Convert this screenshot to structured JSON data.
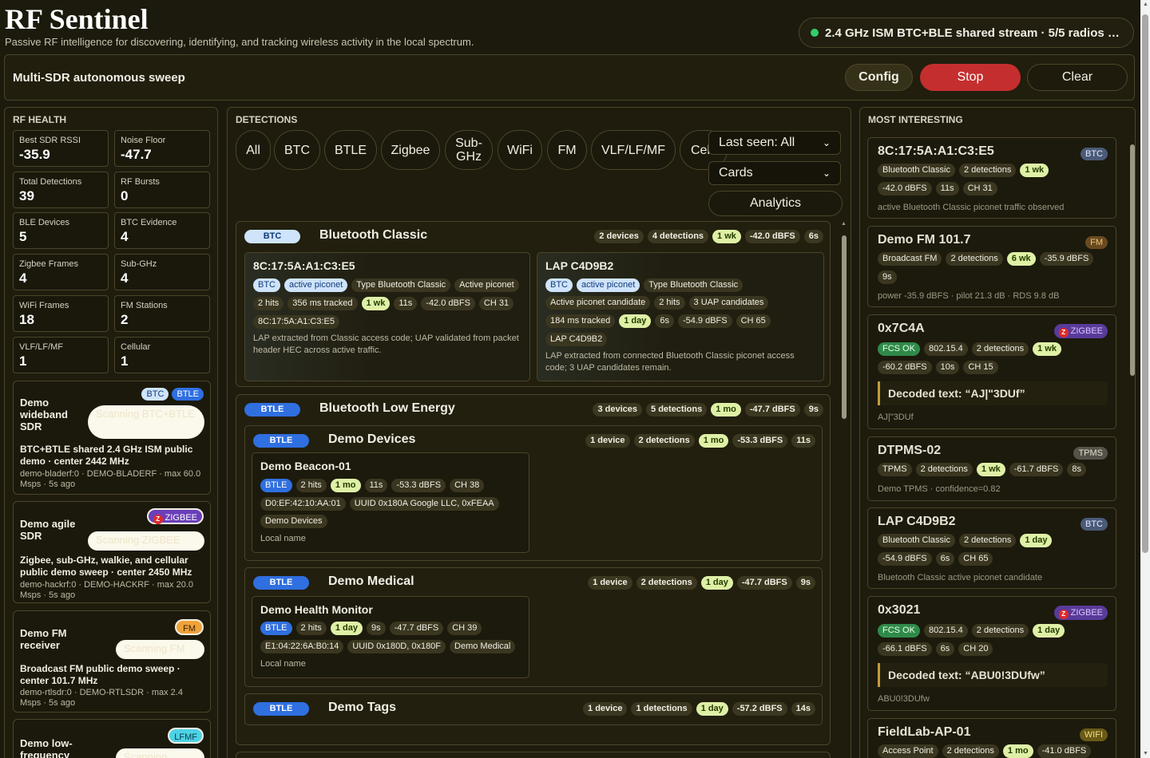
{
  "app": {
    "title": "RF Sentinel",
    "subtitle": "Passive RF intelligence for discovering, identifying, and tracking wireless activity in the local spectrum.",
    "status": "2.4 GHz ISM BTC+BLE shared stream · 5/5 radios …"
  },
  "sweep": {
    "title": "Multi-SDR autonomous sweep",
    "config": "Config",
    "stop": "Stop",
    "clear": "Clear"
  },
  "health": {
    "title": "RF HEALTH",
    "stats": [
      {
        "label": "Best SDR RSSI",
        "value": "-35.9"
      },
      {
        "label": "Noise Floor",
        "value": "-47.7"
      },
      {
        "label": "Total Detections",
        "value": "39"
      },
      {
        "label": "RF Bursts",
        "value": "0"
      },
      {
        "label": "BLE Devices",
        "value": "5"
      },
      {
        "label": "BTC Evidence",
        "value": "4"
      },
      {
        "label": "Zigbee Frames",
        "value": "4"
      },
      {
        "label": "Sub-GHz",
        "value": "4"
      },
      {
        "label": "WiFi Frames",
        "value": "18"
      },
      {
        "label": "FM Stations",
        "value": "2"
      },
      {
        "label": "VLF/LF/MF",
        "value": "1"
      },
      {
        "label": "Cellular",
        "value": "1"
      }
    ],
    "sdrs": [
      {
        "name": "Demo wideband SDR",
        "tags": [
          "BTC",
          "BTLE"
        ],
        "scan": "Scanning BTC+BTLE",
        "desc": "BTC+BTLE shared 2.4 GHz ISM public demo · center 2442 MHz",
        "meta": "demo-bladerf:0 · DEMO-BLADERF · max 60.0 Msps · 5s ago"
      },
      {
        "name": "Demo agile SDR",
        "tags": [
          "ZIGBEE"
        ],
        "scan": "Scanning ZIGBEE",
        "desc": "Zigbee, sub-GHz, walkie, and cellular public demo sweep · center 2450 MHz",
        "meta": "demo-hackrf:0 · DEMO-HACKRF · max 20.0 Msps · 5s ago"
      },
      {
        "name": "Demo FM receiver",
        "tags": [
          "FM"
        ],
        "scan": "Scanning FM",
        "desc": "Broadcast FM public demo sweep · center 101.7 MHz",
        "meta": "demo-rtlsdr:0 · DEMO-RTLSDR · max 2.4 Msps · 5s ago"
      },
      {
        "name": "Demo low-frequency",
        "tags": [
          "LFMF"
        ],
        "scan": "Scanning",
        "desc": "",
        "meta": ""
      }
    ]
  },
  "detections": {
    "title": "DETECTIONS",
    "filters": [
      "All",
      "BTC",
      "BTLE",
      "Zigbee",
      "Sub-GHz",
      "WiFi",
      "FM",
      "VLF/LF/MF",
      "Cel"
    ],
    "last_seen": "Last seen: All",
    "view": "Cards",
    "analytics": "Analytics",
    "groups": [
      {
        "tag": "BTC",
        "name": "Bluetooth Classic",
        "stats": [
          "2 devices",
          "4 detections",
          "1 wk",
          "-42.0 dBFS",
          "6s"
        ],
        "cards": [
          {
            "name": "8C:17:5A:A1:C3:E5",
            "row1": [
              "BTC",
              "active piconet",
              "Type Bluetooth Classic",
              "Active piconet"
            ],
            "row2": [
              "2 hits",
              "356 ms tracked",
              "1 wk",
              "11s",
              "-42.0 dBFS",
              "CH 31"
            ],
            "row3": [
              "8C:17:5A:A1:C3:E5"
            ],
            "note": "LAP extracted from Classic access code; UAP validated from packet header HEC across active traffic."
          },
          {
            "name": "LAP C4D9B2",
            "row1": [
              "BTC",
              "active piconet",
              "Type Bluetooth Classic"
            ],
            "row2": [
              "Active piconet candidate",
              "2 hits",
              "3 UAP candidates"
            ],
            "row3": [
              "184 ms tracked",
              "1 day",
              "6s",
              "-54.9 dBFS",
              "CH 65"
            ],
            "row4": [
              "LAP C4D9B2"
            ],
            "note": "LAP extracted from connected Bluetooth Classic piconet access code; 3 UAP candidates remain."
          }
        ]
      },
      {
        "tag": "BTLE",
        "name": "Bluetooth Low Energy",
        "stats": [
          "3 devices",
          "5 detections",
          "1 mo",
          "-47.7 dBFS",
          "9s"
        ],
        "subgroups": [
          {
            "tag": "BTLE",
            "name": "Demo Devices",
            "stats": [
              "1 device",
              "2 detections",
              "1 mo",
              "-53.3 dBFS",
              "11s"
            ],
            "card": {
              "name": "Demo Beacon-01",
              "row1": [
                "BTLE",
                "2 hits",
                "1 mo",
                "11s",
                "-53.3 dBFS",
                "CH 38"
              ],
              "row2": [
                "D0:EF:42:10:AA:01",
                "UUID 0x180A Google LLC, 0xFEAA"
              ],
              "row3": [
                "Demo Devices"
              ],
              "note": "Local name"
            }
          },
          {
            "tag": "BTLE",
            "name": "Demo Medical",
            "stats": [
              "1 device",
              "2 detections",
              "1 day",
              "-47.7 dBFS",
              "9s"
            ],
            "card": {
              "name": "Demo Health Monitor",
              "row1": [
                "BTLE",
                "2 hits",
                "1 day",
                "9s",
                "-47.7 dBFS",
                "CH 39"
              ],
              "row2": [
                "E1:04:22:6A:B0:14",
                "UUID 0x180D, 0x180F",
                "Demo Medical"
              ],
              "note": "Local name"
            }
          },
          {
            "tag": "BTLE",
            "name": "Demo Tags",
            "stats": [
              "1 device",
              "1 detections",
              "1 day",
              "-57.2 dBFS",
              "14s"
            ]
          }
        ]
      }
    ]
  },
  "interesting": {
    "title": "MOST INTERESTING",
    "items": [
      {
        "name": "8C:17:5A:A1:C3:E5",
        "tag": "BTC",
        "rows": [
          [
            "Bluetooth Classic",
            "2 detections",
            "1 wk"
          ],
          [
            "-42.0 dBFS",
            "11s",
            "CH 31"
          ]
        ],
        "note": "active Bluetooth Classic piconet traffic observed"
      },
      {
        "name": "Demo FM 101.7",
        "tag": "FM",
        "rows": [
          [
            "Broadcast FM",
            "2 detections",
            "6 wk",
            "-35.9 dBFS"
          ],
          [
            "9s"
          ]
        ],
        "note": "power -35.9 dBFS · pilot 21.3 dB · RDS 9.8 dB"
      },
      {
        "name": "0x7C4A",
        "tag": "ZIGBEE",
        "rows": [
          [
            "FCS OK",
            "802.15.4",
            "2 detections",
            "1 wk"
          ],
          [
            "-60.2 dBFS",
            "10s",
            "CH 15"
          ]
        ],
        "decoded": "Decoded text: “AJ|\"3DUf”",
        "note": "AJ|\"3DUf"
      },
      {
        "name": "DTPMS-02",
        "tag": "TPMS",
        "rows": [
          [
            "TPMS",
            "2 detections",
            "1 wk",
            "-61.7 dBFS",
            "8s"
          ]
        ],
        "note": "Demo TPMS · confidence=0.82"
      },
      {
        "name": "LAP C4D9B2",
        "tag": "BTC",
        "rows": [
          [
            "Bluetooth Classic",
            "2 detections",
            "1 day"
          ],
          [
            "-54.9 dBFS",
            "6s",
            "CH 65"
          ]
        ],
        "note": "Bluetooth Classic active piconet candidate"
      },
      {
        "name": "0x3021",
        "tag": "ZIGBEE",
        "rows": [
          [
            "FCS OK",
            "802.15.4",
            "2 detections",
            "1 day"
          ],
          [
            "-66.1 dBFS",
            "6s",
            "CH 20"
          ]
        ],
        "decoded": "Decoded text: “ABU0!3DUfw”",
        "note": "ABU0!3DUfw"
      },
      {
        "name": "FieldLab-AP-01",
        "tag": "WIFI",
        "rows": [
          [
            "Access Point",
            "2 detections",
            "1 mo",
            "-41.0 dBFS"
          ]
        ],
        "note": ""
      }
    ]
  }
}
